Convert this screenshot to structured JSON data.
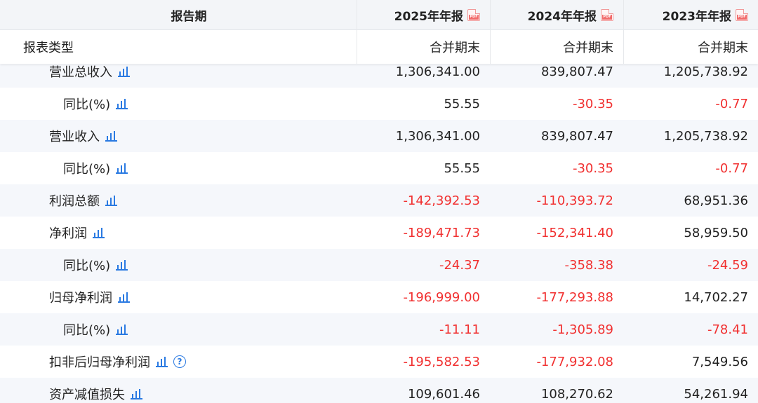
{
  "header": {
    "col0": "报告期",
    "periods": [
      "2025年年报",
      "2024年年报",
      "2023年年报"
    ],
    "pdf_icon_text": "PDF"
  },
  "report_type": {
    "label": "报表类型",
    "values": [
      "合并期末",
      "合并期末",
      "合并期末"
    ]
  },
  "rows": [
    {
      "label": "营业总收入",
      "level": 1,
      "values": [
        "1,306,341.00",
        "839,807.47",
        "1,205,738.92"
      ],
      "neg": [
        false,
        false,
        false
      ]
    },
    {
      "label": "同比(%)",
      "level": 2,
      "values": [
        "55.55",
        "-30.35",
        "-0.77"
      ],
      "neg": [
        false,
        true,
        true
      ]
    },
    {
      "label": "营业收入",
      "level": 1,
      "values": [
        "1,306,341.00",
        "839,807.47",
        "1,205,738.92"
      ],
      "neg": [
        false,
        false,
        false
      ]
    },
    {
      "label": "同比(%)",
      "level": 2,
      "values": [
        "55.55",
        "-30.35",
        "-0.77"
      ],
      "neg": [
        false,
        true,
        true
      ]
    },
    {
      "label": "利润总额",
      "level": 1,
      "values": [
        "-142,392.53",
        "-110,393.72",
        "68,951.36"
      ],
      "neg": [
        true,
        true,
        false
      ]
    },
    {
      "label": "净利润",
      "level": 1,
      "values": [
        "-189,471.73",
        "-152,341.40",
        "58,959.50"
      ],
      "neg": [
        true,
        true,
        false
      ]
    },
    {
      "label": "同比(%)",
      "level": 2,
      "values": [
        "-24.37",
        "-358.38",
        "-24.59"
      ],
      "neg": [
        true,
        true,
        true
      ]
    },
    {
      "label": "归母净利润",
      "level": 1,
      "values": [
        "-196,999.00",
        "-177,293.88",
        "14,702.27"
      ],
      "neg": [
        true,
        true,
        false
      ]
    },
    {
      "label": "同比(%)",
      "level": 2,
      "values": [
        "-11.11",
        "-1,305.89",
        "-78.41"
      ],
      "neg": [
        true,
        true,
        true
      ]
    },
    {
      "label": "扣非后归母净利润",
      "level": 1,
      "help": true,
      "values": [
        "-195,582.53",
        "-177,932.08",
        "7,549.56"
      ],
      "neg": [
        true,
        true,
        false
      ]
    },
    {
      "label": "资产减值损失",
      "level": 1,
      "values": [
        "109,601.46",
        "108,270.62",
        "54,261.94"
      ],
      "neg": [
        false,
        false,
        false
      ]
    }
  ],
  "icons": {
    "chart": "bar-chart-icon",
    "help": "question-circle-icon",
    "pdf": "pdf-file-icon"
  },
  "colors": {
    "negative": "#f13030",
    "link_blue": "#2a7ae2",
    "header_bg": "#f3f5f8",
    "alt_row_bg": "#f5f7fb"
  }
}
